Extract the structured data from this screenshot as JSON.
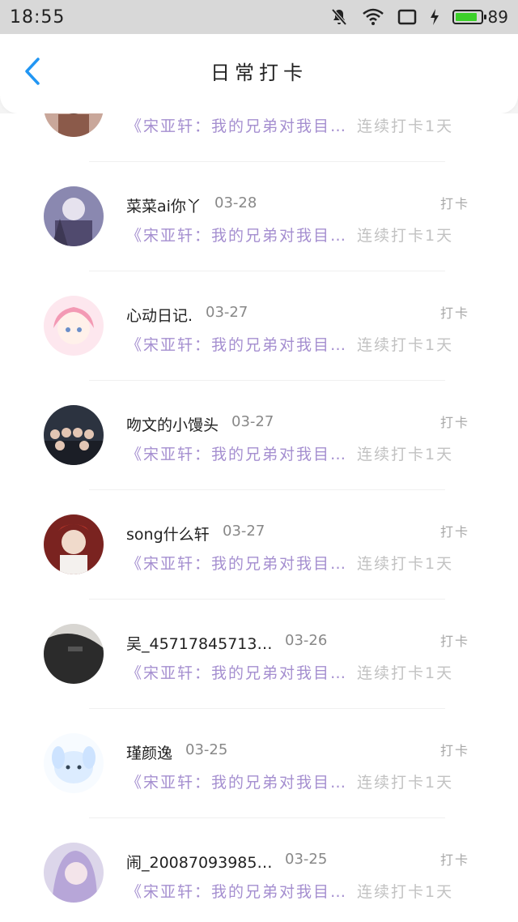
{
  "status": {
    "time": "18:55",
    "battery": "89",
    "battery_level": 0.89,
    "icons": [
      "mute-icon",
      "wifi-icon",
      "screen-icon",
      "charging-icon",
      "battery-icon"
    ]
  },
  "header": {
    "title": "日常打卡",
    "back_icon": "chevron-left-icon"
  },
  "colors": {
    "preview": "#a58fd0",
    "streak": "#c2c2c2",
    "accent": "#2196f3"
  },
  "items": [
    {
      "name": "",
      "date": "",
      "action": "",
      "preview": "《宋亚轩：我的兄弟对我目…",
      "streak": "连续打卡1天"
    },
    {
      "name": "菜菜ai你丫",
      "date": "03-28",
      "action": "打卡",
      "preview": "《宋亚轩：我的兄弟对我目…",
      "streak": "连续打卡1天"
    },
    {
      "name": "心动日记.",
      "date": "03-27",
      "action": "打卡",
      "preview": "《宋亚轩：我的兄弟对我目…",
      "streak": "连续打卡1天"
    },
    {
      "name": "吻文的小馒头",
      "date": "03-27",
      "action": "打卡",
      "preview": "《宋亚轩：我的兄弟对我目…",
      "streak": "连续打卡1天"
    },
    {
      "name": "song什么轩",
      "date": "03-27",
      "action": "打卡",
      "preview": "《宋亚轩：我的兄弟对我目…",
      "streak": "连续打卡1天"
    },
    {
      "name": "吴_45717845713…",
      "date": "03-26",
      "action": "打卡",
      "preview": "《宋亚轩：我的兄弟对我目…",
      "streak": "连续打卡1天"
    },
    {
      "name": "瑾颜逸",
      "date": "03-25",
      "action": "打卡",
      "preview": "《宋亚轩：我的兄弟对我目…",
      "streak": "连续打卡1天"
    },
    {
      "name": "闹_20087093985…",
      "date": "03-25",
      "action": "打卡",
      "preview": "《宋亚轩：我的兄弟对我目…",
      "streak": "连续打卡1天"
    }
  ]
}
